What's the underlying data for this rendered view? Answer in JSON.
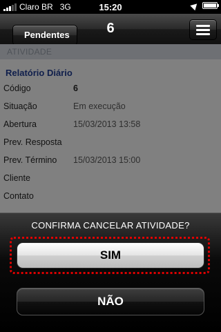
{
  "status_bar": {
    "carrier": "Claro BR",
    "network": "3G",
    "time": "15:20"
  },
  "nav": {
    "back_label": "Pendentes",
    "title": "6"
  },
  "content": {
    "section_header": "ATIVIDADE",
    "doc_title": "Relatório Diário",
    "rows": [
      {
        "label": "Código",
        "value": "6"
      },
      {
        "label": "Situação",
        "value": "Em execução"
      },
      {
        "label": "Abertura",
        "value": "15/03/2013 13:58"
      },
      {
        "label": "Prev. Resposta",
        "value": ""
      },
      {
        "label": "Prev. Término",
        "value": "15/03/2013 15:00"
      },
      {
        "label": "Cliente",
        "value": ""
      },
      {
        "label": "Contato",
        "value": ""
      }
    ]
  },
  "action_sheet": {
    "title": "CONFIRMA CANCELAR ATIVIDADE?",
    "confirm_label": "SIM",
    "cancel_label": "NÃO"
  },
  "colors": {
    "focus_ring": "#e00000",
    "doc_title": "#1e3a8a"
  }
}
